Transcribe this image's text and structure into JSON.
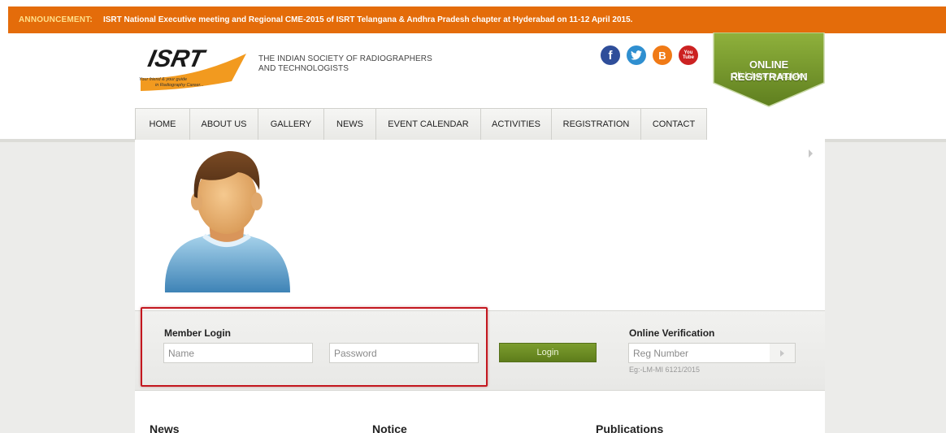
{
  "announcement": {
    "label": "ANNOUNCEMENT:",
    "text": "ISRT National Executive meeting and Regional CME-2015 of ISRT Telangana & Andhra Pradesh chapter at Hyderabad on 11-12 April 2015."
  },
  "header": {
    "logo_text": "ISRT",
    "logo_tagline_1": "Your friend & your guide",
    "logo_tagline_2": "in Radiography Career...",
    "org_name_line1": "THE INDIAN SOCIETY OF RADIOGRAPHERS",
    "org_name_line2": "AND TECHNOLOGISTS",
    "social": {
      "facebook_glyph": "f",
      "twitter_glyph": "t",
      "blogger_glyph": "B",
      "youtube_glyph_1": "You",
      "youtube_glyph_2": "Tube"
    },
    "registration": {
      "title": "ONLINE REGISTRATION",
      "subtitle": "Click here to register"
    }
  },
  "nav": {
    "items": [
      {
        "label": "HOME",
        "width": 0
      },
      {
        "label": "ABOUT US"
      },
      {
        "label": "GALLERY"
      },
      {
        "label": "NEWS"
      },
      {
        "label": "EVENT CALENDAR"
      },
      {
        "label": "ACTIVITIES"
      },
      {
        "label": "REGISTRATION"
      },
      {
        "label": "CONTACT"
      }
    ]
  },
  "login": {
    "title": "Member Login",
    "name_placeholder": "Name",
    "password_placeholder": "Password",
    "button_label": "Login"
  },
  "verification": {
    "title": "Online Verification",
    "placeholder": "Reg Number",
    "hint": "Eg:-LM-MI 6121/2015"
  },
  "sections": {
    "news": "News",
    "notice": "Notice",
    "publications": "Publications"
  },
  "colors": {
    "announcement_bg": "#e46c0a",
    "accent_green": "#6b8c22",
    "highlight_red": "#c3171f"
  }
}
